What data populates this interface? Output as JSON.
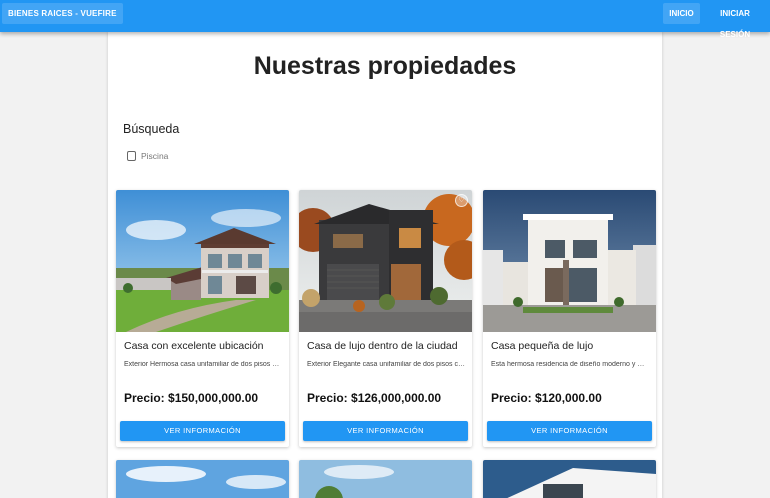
{
  "appbar": {
    "brand": "BIENES RAICES - VUEFIRE",
    "nav": {
      "home": "INICIO",
      "login": "INICIAR SESIÓN"
    }
  },
  "main": {
    "title": "Nuestras propiedades",
    "search": {
      "heading": "Búsqueda",
      "filters": [
        {
          "label": "Piscina",
          "checked": false
        }
      ]
    },
    "properties": [
      {
        "title": "Casa con excelente ubicación",
        "description": "Exterior Hermosa casa unifamiliar de dos pisos con amplio jardín",
        "price": "Precio: $150,000,000.00",
        "button": "VER INFORMACIÓN"
      },
      {
        "title": "Casa de lujo dentro de la ciudad",
        "description": "Exterior Elegante casa unifamiliar de dos pisos con fachada oscura",
        "price": "Precio: $126,000,000.00",
        "button": "VER INFORMACIÓN"
      },
      {
        "title": "Casa pequeña de lujo",
        "description": "Esta hermosa residencia de diseño moderno y minimalista",
        "price": "Precio: $120,000.00",
        "button": "VER INFORMACIÓN"
      }
    ]
  },
  "icons": {
    "favorite": "heart-icon",
    "checkbox": "checkbox-unchecked-icon"
  },
  "colors": {
    "primary": "#2196f3",
    "primary_light": "#42a5f5",
    "page_background": "#f2f2f2",
    "card_background": "#ffffff"
  }
}
